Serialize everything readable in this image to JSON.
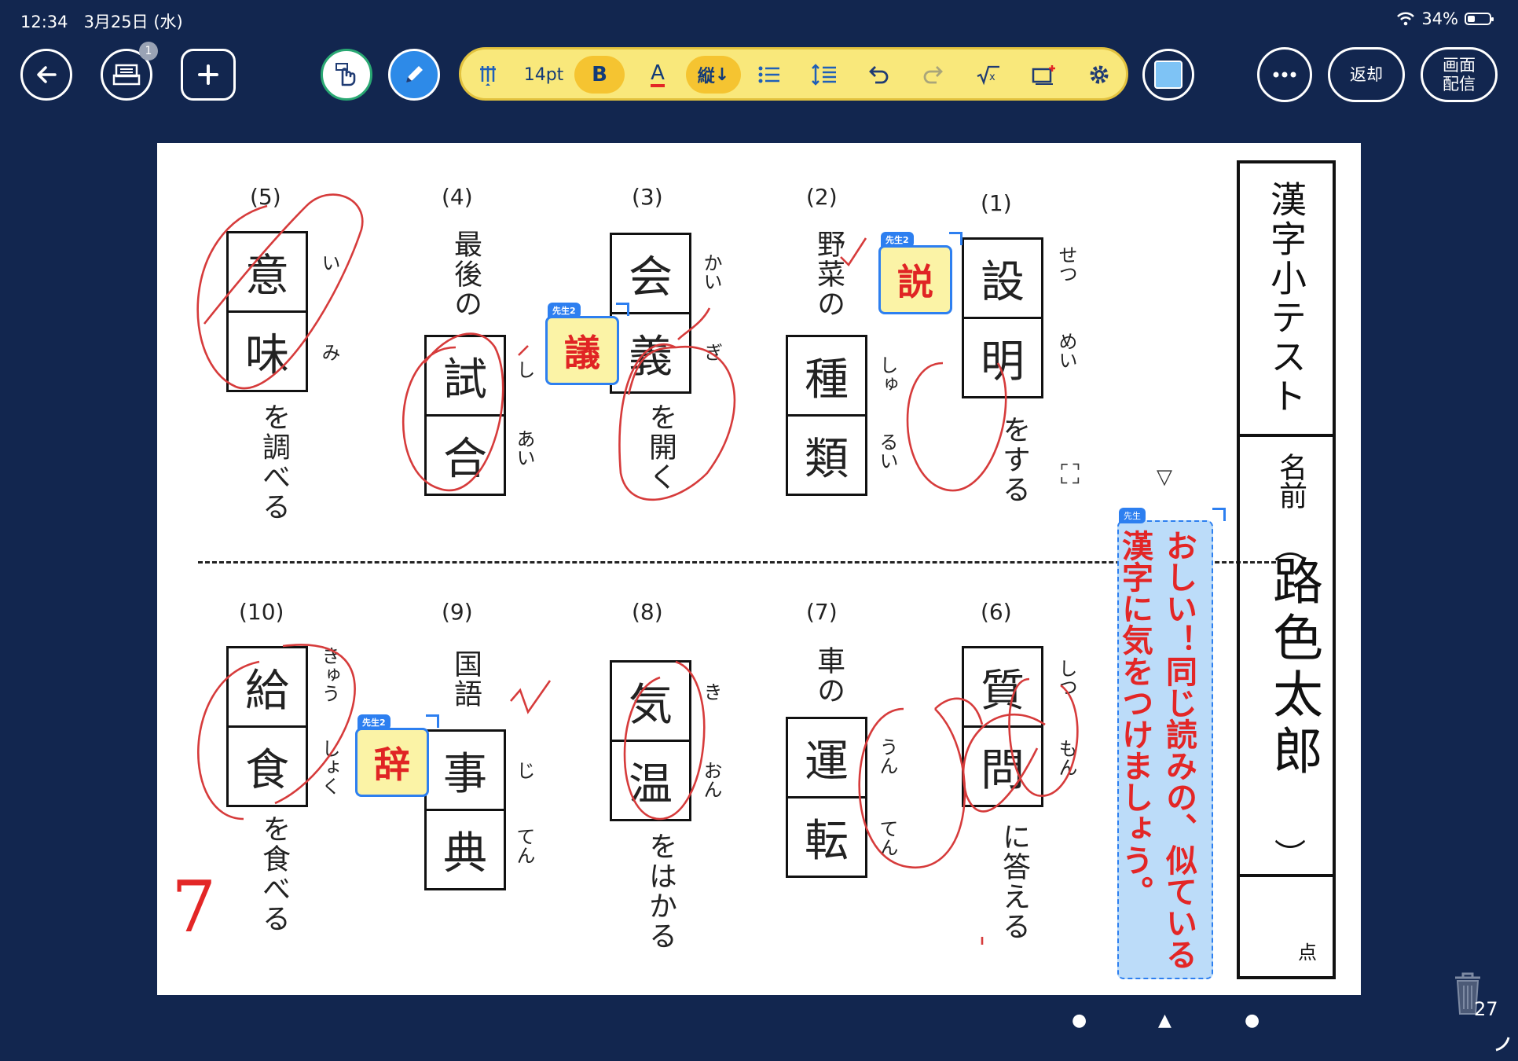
{
  "status": {
    "time": "12:34",
    "date": "3月25日 (水)",
    "battery": "34%"
  },
  "toolbar": {
    "badge": "1",
    "font_size": "14pt",
    "bold": "B",
    "color_a": "A",
    "vertical": "縦",
    "return_label": "返却",
    "screen_share_label": "画面\n配信"
  },
  "paper": {
    "title": "漢字小テスト",
    "name_label": "名前",
    "name_value": "路色太郎",
    "paren_open": "︵",
    "paren_close": "︶",
    "score": "7",
    "score_unit": "点",
    "comment_tag": "先生",
    "comment": "おしい！同じ読みの、似ている漢字に気をつけましょう。",
    "sticker_tag": "先生2",
    "questions": [
      {
        "num": "(1)",
        "pre": "",
        "kanji": [
          "設",
          "明"
        ],
        "kana": [
          "せつ",
          "めい"
        ],
        "post": "をする"
      },
      {
        "num": "(2)",
        "pre": "野菜の",
        "kanji": [
          "種",
          "類"
        ],
        "kana": [
          "しゅ",
          "るい"
        ],
        "post": ""
      },
      {
        "num": "(3)",
        "pre": "",
        "kanji": [
          "会",
          "義"
        ],
        "kana": [
          "かい",
          "ぎ"
        ],
        "post": "を開く"
      },
      {
        "num": "(4)",
        "pre": "最後の",
        "kanji": [
          "試",
          "合"
        ],
        "kana": [
          "し",
          "あい"
        ],
        "post": ""
      },
      {
        "num": "(5)",
        "pre": "",
        "kanji": [
          "意",
          "味"
        ],
        "kana": [
          "い",
          "み"
        ],
        "post": "を調べる"
      },
      {
        "num": "(6)",
        "pre": "",
        "kanji": [
          "質",
          "問"
        ],
        "kana": [
          "しつ",
          "もん"
        ],
        "post": "に答える"
      },
      {
        "num": "(7)",
        "pre": "車の",
        "kanji": [
          "運",
          "転"
        ],
        "kana": [
          "うん",
          "てん"
        ],
        "post": ""
      },
      {
        "num": "(8)",
        "pre": "",
        "kanji": [
          "気",
          "温"
        ],
        "kana": [
          "き",
          "おん"
        ],
        "post": "をはかる"
      },
      {
        "num": "(9)",
        "pre": "国語",
        "kanji": [
          "事",
          "典"
        ],
        "kana": [
          "じ",
          "てん"
        ],
        "post": ""
      },
      {
        "num": "(10)",
        "pre": "",
        "kanji": [
          "給",
          "食"
        ],
        "kana": [
          "きゅう",
          "しょく"
        ],
        "post": "を食べる"
      }
    ],
    "corrections": [
      "説",
      "議",
      "辞"
    ]
  },
  "footer": {
    "page_number": "27"
  }
}
